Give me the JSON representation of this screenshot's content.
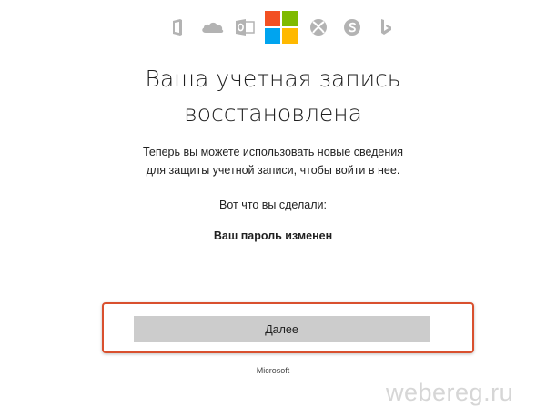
{
  "header": {
    "icons": [
      "office-icon",
      "onedrive-icon",
      "outlook-icon",
      "microsoft-logo",
      "xbox-icon",
      "skype-icon",
      "bing-icon"
    ],
    "logo_colors": {
      "red": "#f25022",
      "green": "#7fba00",
      "blue": "#00a4ef",
      "yellow": "#ffb900"
    },
    "icon_color": "#b3b3b3"
  },
  "main": {
    "title_line1": "Ваша учетная запись",
    "title_line2": "восстановлена",
    "description_line1": "Теперь вы можете использовать новые сведения",
    "description_line2": "для защиты учетной записи, чтобы войти в нее.",
    "done_label": "Вот что вы сделали:",
    "done_item": "Ваш пароль изменен"
  },
  "actions": {
    "next_label": "Далее",
    "highlight_color": "#d9502e"
  },
  "footer": {
    "brand": "Microsoft"
  },
  "watermark": {
    "text": "webereg.ru"
  }
}
